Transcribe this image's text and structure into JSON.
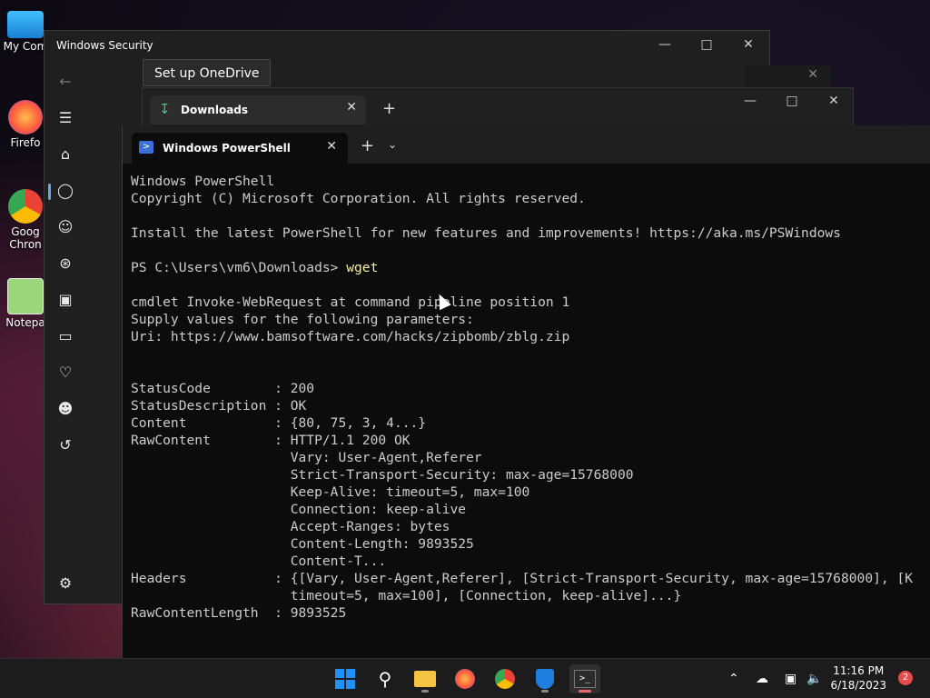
{
  "desktop": {
    "icons": [
      {
        "label": "My Com"
      },
      {
        "label": "Firefo"
      },
      {
        "label": "Goog"
      },
      {
        "label": "Chron"
      },
      {
        "label": "Notepa"
      }
    ]
  },
  "windows_security": {
    "title": "Windows Security",
    "nav_icons": [
      "back-arrow-icon",
      "menu-icon",
      "home-icon",
      "shield-icon",
      "account-icon",
      "wireless-icon",
      "app-browser-icon",
      "device-icon",
      "health-icon",
      "family-icon",
      "history-icon",
      "settings-icon"
    ]
  },
  "onedrive_tooltip": "Set up OneDrive",
  "downloads_window": {
    "tab_label": "Downloads"
  },
  "terminal": {
    "tab_label": "Windows PowerShell",
    "lines": [
      "Windows PowerShell",
      "Copyright (C) Microsoft Corporation. All rights reserved.",
      "",
      "Install the latest PowerShell for new features and improvements! https://aka.ms/PSWindows",
      "",
      "PS C:\\Users\\vm6\\Downloads> ",
      "",
      "cmdlet Invoke-WebRequest at command pipeline position 1",
      "Supply values for the following parameters:",
      "Uri: https://www.bamsoftware.com/hacks/zipbomb/zblg.zip",
      "",
      "",
      "StatusCode        : 200",
      "StatusDescription : OK",
      "Content           : {80, 75, 3, 4...}",
      "RawContent        : HTTP/1.1 200 OK",
      "                    Vary: User-Agent,Referer",
      "                    Strict-Transport-Security: max-age=15768000",
      "                    Keep-Alive: timeout=5, max=100",
      "                    Connection: keep-alive",
      "                    Accept-Ranges: bytes",
      "                    Content-Length: 9893525",
      "                    Content-T...",
      "Headers           : {[Vary, User-Agent,Referer], [Strict-Transport-Security, max-age=15768000], [K",
      "                    timeout=5, max=100], [Connection, keep-alive]...}",
      "RawContentLength  : 9893525"
    ],
    "typed_command": "wget",
    "typed_command_line_index": 5
  },
  "taskbar": {
    "apps": [
      "windows-start-icon",
      "search-icon",
      "file-explorer-icon",
      "firefox-icon",
      "chrome-icon",
      "windows-security-icon",
      "terminal-icon"
    ],
    "time": "11:16 PM",
    "date": "6/18/2023",
    "notification_count": "2"
  }
}
